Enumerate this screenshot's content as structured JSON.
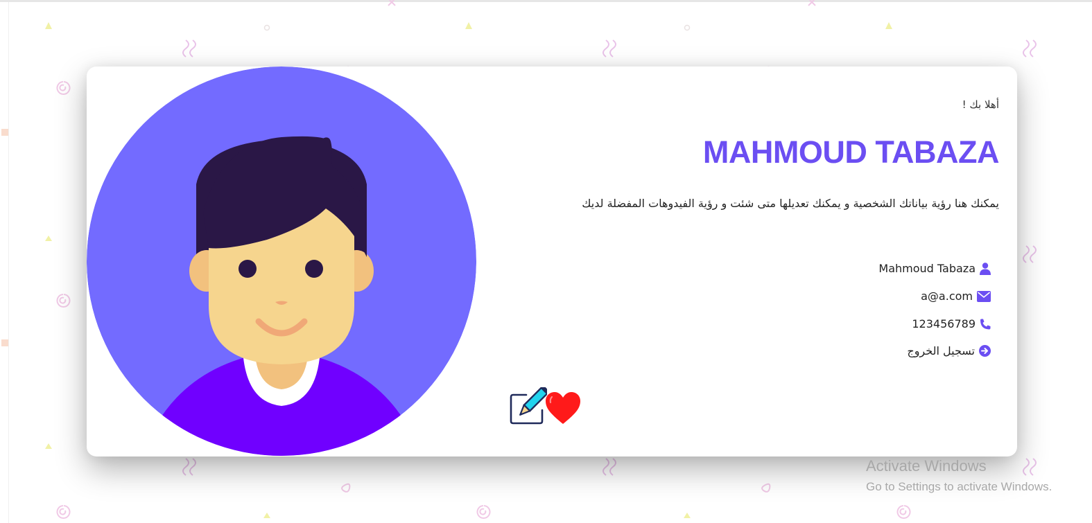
{
  "profile": {
    "greeting": "أهلا بك !",
    "name": "MAHMOUD TABAZA",
    "description": "يمكنك هنا رؤية بياناتك الشخصية و يمكنك تعديلها متى شئت و رؤية الفيدوهات المفضلة لديك"
  },
  "info": {
    "username": "Mahmoud Tabaza",
    "email": "a@a.com",
    "phone": "123456789",
    "logout_label": "تسجيل الخروج"
  },
  "icons": {
    "user": "user-icon",
    "email": "envelope-icon",
    "phone": "phone-icon",
    "logout": "arrow-circle-right-icon",
    "edit": "pencil-square-icon",
    "favorite": "heart-icon"
  },
  "colors": {
    "accent": "#6b4ef2",
    "avatar_bg": "#736bff",
    "hair": "#2a1746",
    "skin": "#f6d58e",
    "shirt": "#7000ff",
    "heart": "#ff1a1a"
  },
  "watermark": {
    "title": "Activate Windows",
    "subtitle": "Go to Settings to activate Windows."
  }
}
